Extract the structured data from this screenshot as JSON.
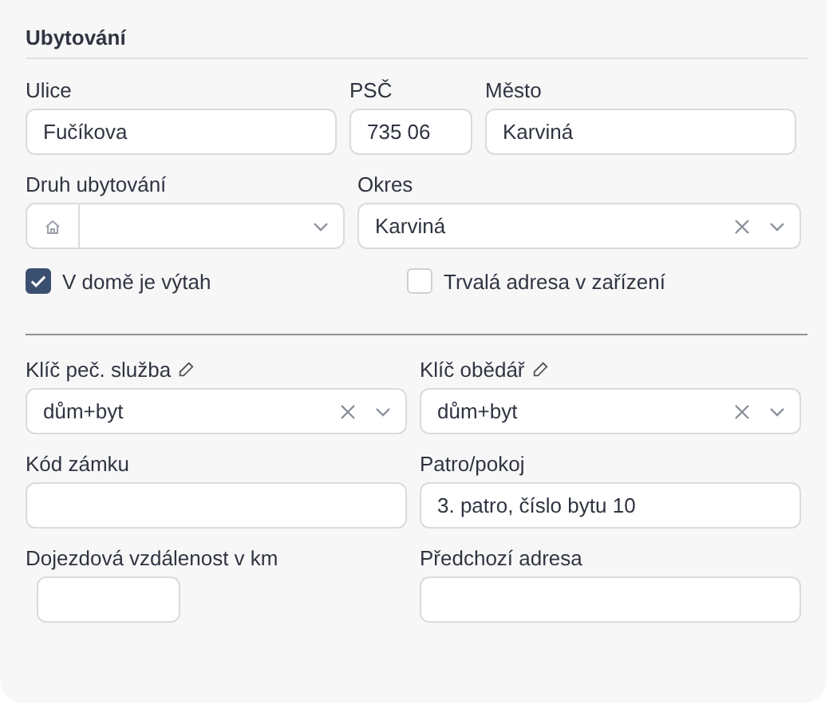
{
  "title": "Ubytování",
  "upper": [
    [
      {
        "kind": "text",
        "label": "Ulice",
        "value": "Fučíkova"
      },
      {
        "kind": "text",
        "label": "PSČ",
        "value": "735 06"
      },
      {
        "kind": "text",
        "label": "Město",
        "value": "Karviná"
      }
    ],
    [
      {
        "kind": "icon-select",
        "label": "Druh ubytování"
      },
      {
        "kind": "select",
        "label": "Okres",
        "value": "Karviná",
        "clearable": true
      }
    ],
    [
      {
        "kind": "checkbox",
        "label": "V domě je výtah",
        "checked": true
      },
      {
        "kind": "checkbox",
        "label": "Trvalá adresa v zařízení",
        "checked": false
      }
    ]
  ],
  "lower": [
    [
      {
        "kind": "select",
        "label": "Klíč peč. služba",
        "editable": true,
        "value": "dům+byt",
        "clearable": true
      },
      {
        "kind": "select",
        "label": "Klíč obědář",
        "editable": true,
        "value": "dům+byt",
        "clearable": true
      }
    ],
    [
      {
        "kind": "text",
        "label": "Kód zámku"
      },
      {
        "kind": "text",
        "label": "Patro/pokoj",
        "value": "3. patro, číslo bytu 10"
      }
    ],
    [
      {
        "kind": "text",
        "label": "Dojezdová vzdálenost v km"
      },
      {
        "kind": "text",
        "label": "Předchozí adresa"
      }
    ]
  ]
}
